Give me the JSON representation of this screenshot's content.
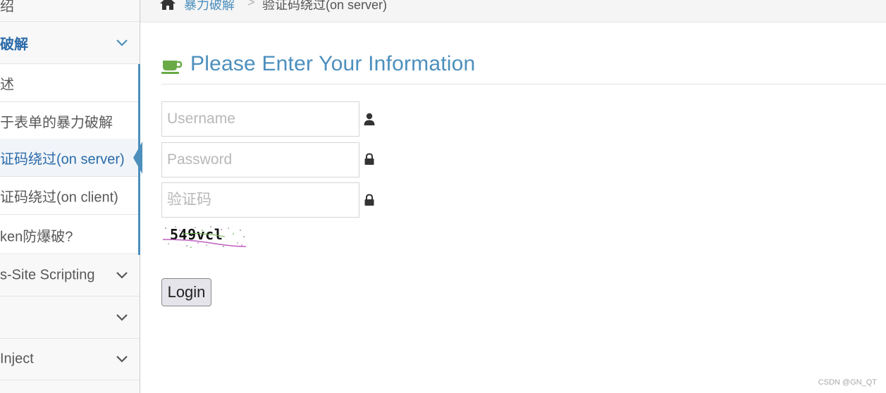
{
  "sidebar": {
    "intro_label": "绍",
    "brute_label": "破解",
    "brute_items": [
      {
        "label": "述"
      },
      {
        "label": "于表单的暴力破解"
      },
      {
        "label": "证码绕过(on server)",
        "active": true
      },
      {
        "label": "证码绕过(on client)"
      },
      {
        "label": "ken防爆破?"
      }
    ],
    "xss_label": "s-Site Scripting",
    "csrf_label": "",
    "inject_label": "Inject"
  },
  "breadcrumb": {
    "link_label": "暴力破解",
    "separator": ">",
    "current_label": "验证码绕过(on server)"
  },
  "main": {
    "title": "Please Enter Your Information",
    "form": {
      "username_placeholder": "Username",
      "password_placeholder": "Password",
      "captcha_placeholder": "验证码",
      "captcha_image_text": "549vcl",
      "login_label": "Login"
    }
  },
  "watermark": "CSDN @GN_QT",
  "colors": {
    "accent_blue": "#4c8fbd",
    "active_link": "#2a6aa8",
    "cup_green": "#69aa46"
  },
  "icons": {
    "home": "home-icon",
    "cup": "coffee-cup-icon",
    "user": "user-icon",
    "lock": "lock-icon",
    "chevron": "chevron-down-icon"
  }
}
